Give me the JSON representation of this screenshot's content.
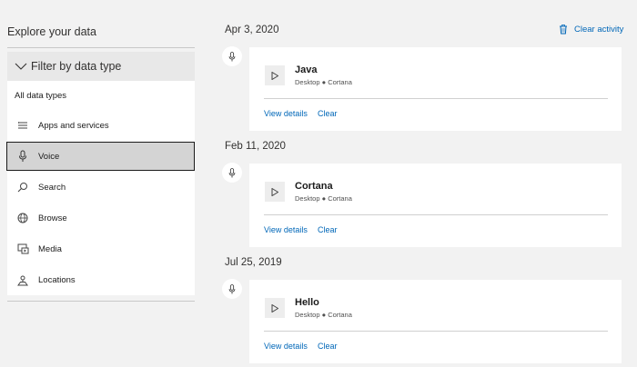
{
  "sidebar": {
    "title": "Explore your data",
    "filter_label": "Filter by data type",
    "all_types_label": "All data types",
    "items": [
      {
        "label": "Apps and services",
        "icon": "list-icon"
      },
      {
        "label": "Voice",
        "icon": "microphone-icon",
        "active": true
      },
      {
        "label": "Search",
        "icon": "search-icon"
      },
      {
        "label": "Browse",
        "icon": "globe-icon"
      },
      {
        "label": "Media",
        "icon": "media-icon"
      },
      {
        "label": "Locations",
        "icon": "location-icon"
      }
    ]
  },
  "header": {
    "clear_activity_label": "Clear activity"
  },
  "activities": [
    {
      "date": "Apr 3, 2020",
      "title": "Java",
      "subtitle": "Desktop ● Cortana",
      "view_label": "View details",
      "clear_label": "Clear"
    },
    {
      "date": "Feb 11, 2020",
      "title": "Cortana",
      "subtitle": "Desktop ● Cortana",
      "view_label": "View details",
      "clear_label": "Clear"
    },
    {
      "date": "Jul 25, 2019",
      "title": "Hello",
      "subtitle": "Desktop ● Cortana",
      "view_label": "View details",
      "clear_label": "Clear"
    }
  ],
  "colors": {
    "link": "#0067b8",
    "background": "#f2f2f2",
    "active_item": "#d4d4d4"
  }
}
